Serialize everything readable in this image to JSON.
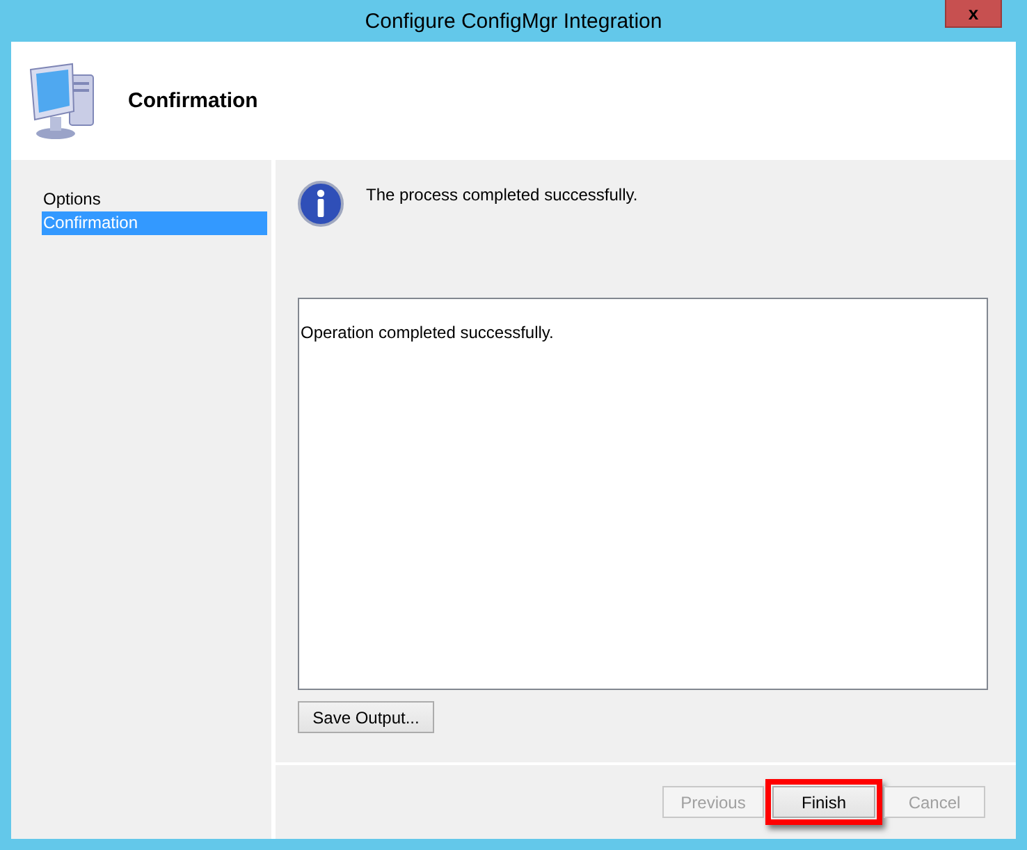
{
  "window": {
    "title": "Configure ConfigMgr Integration",
    "close_glyph": "x"
  },
  "header": {
    "title": "Confirmation"
  },
  "sidebar": {
    "items": [
      {
        "label": "Options",
        "selected": false
      },
      {
        "label": "Confirmation",
        "selected": true
      }
    ]
  },
  "message": "The process completed successfully.",
  "output": {
    "value": "Operation completed successfully."
  },
  "save_button": {
    "label": "Save Output..."
  },
  "buttons": [
    {
      "label": "Previous",
      "disabled": true,
      "highlighted": false
    },
    {
      "label": "Finish",
      "disabled": false,
      "highlighted": true
    },
    {
      "label": "Cancel",
      "disabled": true,
      "highlighted": false
    }
  ]
}
